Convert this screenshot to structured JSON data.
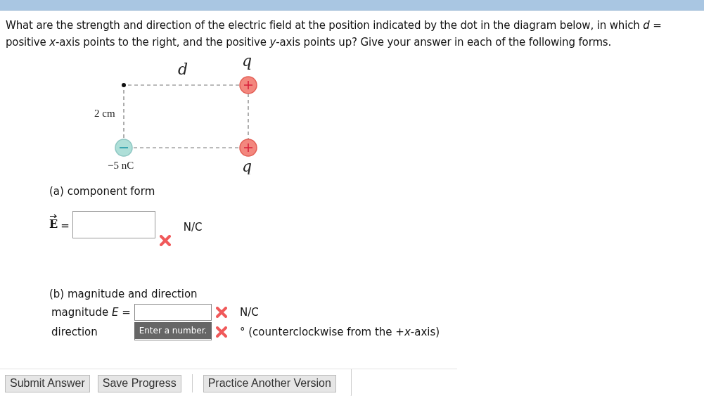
{
  "question": {
    "lines": [
      "What are the strength and direction of the electric field at the position indicated by the dot in the diagram below, in which *d* =",
      "positive *x*-axis points to the right, and the positive *y*-axis points up? Give your answer in each of the following forms."
    ]
  },
  "diagram": {
    "distance_label": "d",
    "top_charge_label": "q",
    "side_label": "2 cm",
    "bottom_left_label": "−5 nC",
    "bottom_right_label": "q"
  },
  "part_a": {
    "label": "(a) component form",
    "field_label": "E",
    "vector": true,
    "equals": "=",
    "unit": "N/C",
    "incorrect": true
  },
  "part_b": {
    "label": "(b) magnitude and direction",
    "rows": [
      {
        "label": "magnitude *E* =",
        "unit": "N/C",
        "incorrect": true
      },
      {
        "label": "direction",
        "unit": "° (counterclockwise from the +*x*-axis)",
        "incorrect": true,
        "tooltip": "Enter a number."
      }
    ]
  },
  "buttons": [
    "Submit Answer",
    "Save Progress",
    "Practice Another Version"
  ]
}
